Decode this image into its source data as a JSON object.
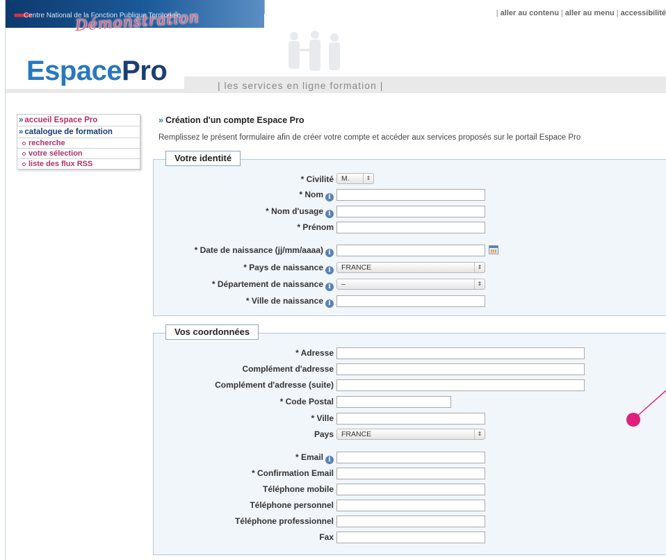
{
  "header": {
    "org_name": "Centre National de la Fonction Publique Territoriale",
    "org_dots": "■■■■■",
    "demo_stamp": "Démonstration",
    "top_links": [
      "aller au contenu",
      "aller au menu",
      "accessibilité"
    ],
    "logo_espace": "Espace",
    "logo_pro": "Pro",
    "tagline": "| les services en ligne formation |"
  },
  "sidebar": {
    "items": [
      {
        "label": "accueil Espace Pro",
        "arrow": "»"
      },
      {
        "label": "catalogue de formation",
        "arrow": "»"
      }
    ],
    "subitems": [
      "recherche",
      "votre sélection",
      "liste des flux RSS"
    ]
  },
  "main": {
    "title_arrow": "»",
    "title": "Création d'un compte Espace Pro",
    "intro": "Remplissez le présent formulaire afin de créer votre compte et accéder aux services proposés sur le portail Espace Pro"
  },
  "identity": {
    "legend": "Votre identité",
    "civilite_label": "* Civilité",
    "civilite_value": "M.",
    "nom_label": "* Nom",
    "nom_usage_label": "* Nom d'usage",
    "prenom_label": "* Prénom",
    "date_label": "* Date de naissance (jj/mm/aaaa)",
    "pays_label": "* Pays de naissance",
    "pays_value": "FRANCE",
    "dept_label": "* Département de naissance",
    "dept_value": "–",
    "ville_label": "* Ville de naissance"
  },
  "coords": {
    "legend": "Vos coordonnées",
    "adresse_label": "* Adresse",
    "complement_label": "Complément d'adresse",
    "complement2_label": "Complément d'adresse (suite)",
    "cp_label": "* Code Postal",
    "ville_label": "* Ville",
    "pays_label": "Pays",
    "pays_value": "FRANCE",
    "email_label": "* Email",
    "email_confirm_label": "* Confirmation Email",
    "tel_mobile_label": "Téléphone mobile",
    "tel_perso_label": "Téléphone personnel",
    "tel_pro_label": "Téléphone professionnel",
    "fax_label": "Fax"
  },
  "icons": {
    "info": "i",
    "stepper": "⇕"
  },
  "colors": {
    "accent_blue": "#2878c0",
    "dark_blue": "#1c3f73",
    "magenta": "#b0306a",
    "annotation": "#e0207a"
  }
}
